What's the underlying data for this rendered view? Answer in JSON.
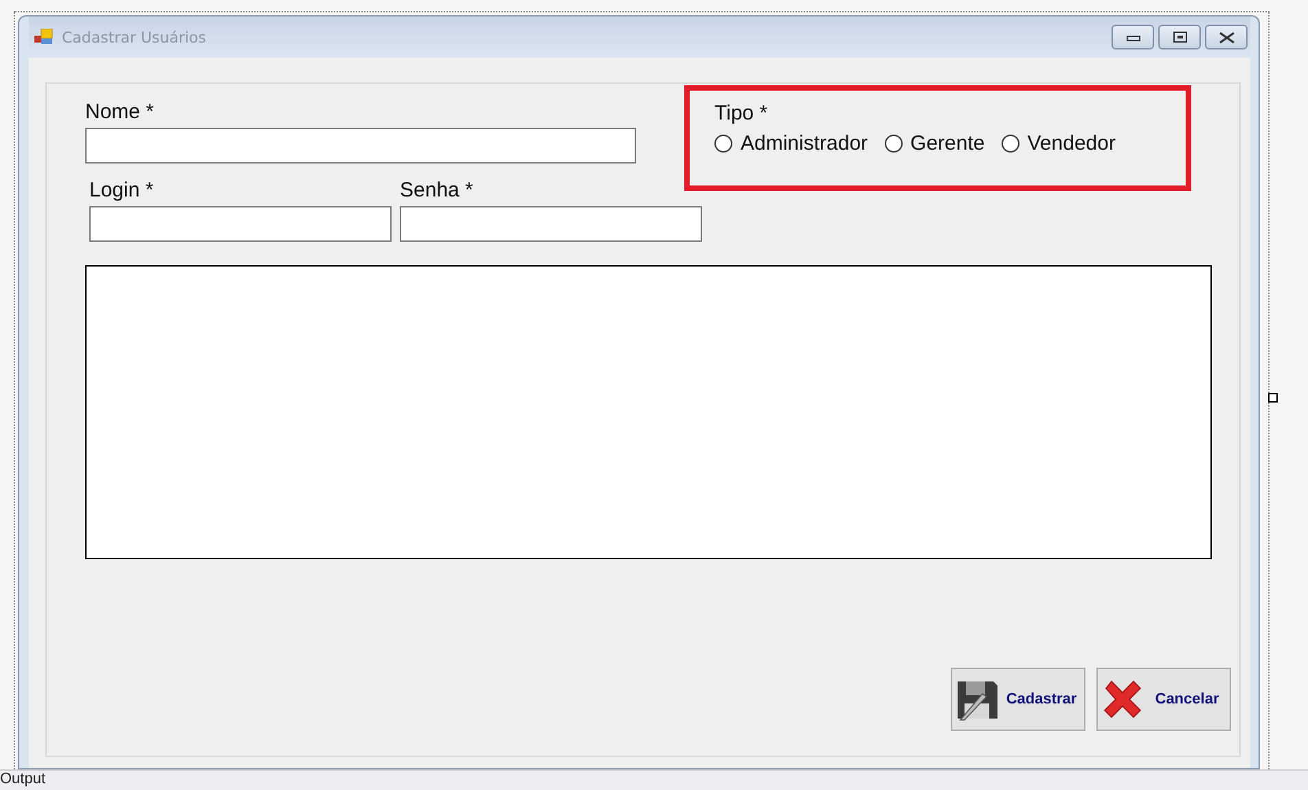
{
  "window": {
    "title": "Cadastrar Usuários"
  },
  "fields": [
    {
      "label": "Nome *"
    },
    {
      "label": "Login *"
    },
    {
      "label": "Senha *"
    }
  ],
  "tipo": {
    "label": "Tipo *",
    "options": [
      {
        "label": "Administrador",
        "selected": false
      },
      {
        "label": "Gerente",
        "selected": false
      },
      {
        "label": "Vendedor",
        "selected": false
      }
    ]
  },
  "buttons": [
    {
      "label": "Cadastrar",
      "kind": "save"
    },
    {
      "label": "Cancelar",
      "kind": "cancel"
    }
  ],
  "status_bar": {
    "label": "Output"
  }
}
